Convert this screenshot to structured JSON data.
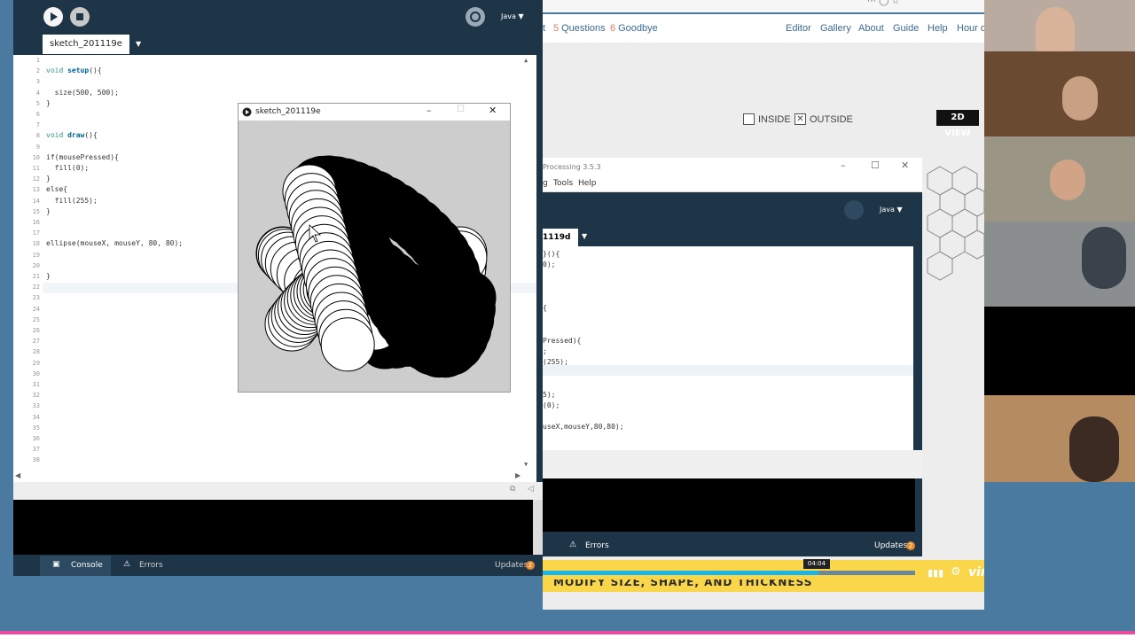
{
  "website": {
    "nav": [
      {
        "num": "5",
        "label": "Questions"
      },
      {
        "num": "6",
        "label": "Goodbye"
      }
    ],
    "nav_right": [
      "Editor",
      "Gallery",
      "About",
      "Guide",
      "Help",
      "Hour o"
    ],
    "partial_tab": "t",
    "inside_label": "INSIDE",
    "outside_label": "OUTSIDE",
    "view_button": "2D VIEW"
  },
  "processing2": {
    "title": "Processing 3.5.3",
    "menu": [
      "g",
      "Tools",
      "Help"
    ],
    "mode": "Java ▼",
    "tab": "1119d",
    "code": [
      {
        "row": 0,
        "text": "}(){"
      },
      {
        "row": 1,
        "text": "0);"
      },
      {
        "row": 5,
        "text": "{"
      },
      {
        "row": 8,
        "text": "Pressed){"
      },
      {
        "row": 9,
        "text": ";"
      },
      {
        "row": 10,
        "text": "(255);"
      },
      {
        "row": 13,
        "text": "5);"
      },
      {
        "row": 14,
        "text": "(0);"
      },
      {
        "row": 16,
        "text": "useX,mouseY,80,80);"
      }
    ],
    "errors_label": "Errors",
    "updates_label": "Updates",
    "updates_count": "2"
  },
  "ide": {
    "mode": "Java ▼",
    "tab_name": "sketch_201119e",
    "line_numbers": [
      "1",
      "2",
      "3",
      "4",
      "5",
      "6",
      "7",
      "8",
      "9",
      "10",
      "11",
      "12",
      "13",
      "14",
      "15",
      "16",
      "17",
      "18",
      "19",
      "20",
      "21",
      "22",
      "23",
      "24",
      "25",
      "26",
      "27",
      "28",
      "29",
      "30",
      "31",
      "32",
      "33",
      "34",
      "35",
      "36",
      "37",
      "38"
    ],
    "code_lines": [
      {
        "row": 1,
        "kw": "void",
        "fn": "setup",
        "rest": "(){"
      },
      {
        "row": 3,
        "text": "  size(500, 500);"
      },
      {
        "row": 4,
        "text": "}"
      },
      {
        "row": 7,
        "kw": "void",
        "fn": "draw",
        "rest": "(){"
      },
      {
        "row": 9,
        "text": "if(mousePressed){"
      },
      {
        "row": 10,
        "text": "  fill(0);"
      },
      {
        "row": 11,
        "text": "}"
      },
      {
        "row": 12,
        "text": "else{"
      },
      {
        "row": 13,
        "text": "  fill(255);"
      },
      {
        "row": 14,
        "text": "}"
      },
      {
        "row": 17,
        "text": "ellipse(mouseX, mouseY, 80, 80);"
      },
      {
        "row": 20,
        "text": "}"
      }
    ],
    "console_label": "Console",
    "errors_label": "Errors",
    "updates_label": "Updates",
    "updates_count": "2"
  },
  "sketch_window": {
    "title": "sketch_201119e"
  },
  "video": {
    "timecode": "04:04",
    "logo": "vimeo",
    "caption": "MODIFY SIZE, SHAPE, AND THICKNESS",
    "progress": 0.74
  },
  "colors": {
    "ide_bg": "#1e3548",
    "accent_blue": "#4a7aa0",
    "vimeo_yellow": "#f9d64a",
    "progress_blue": "#18b5e6",
    "updates_orange": "#e8892c"
  }
}
